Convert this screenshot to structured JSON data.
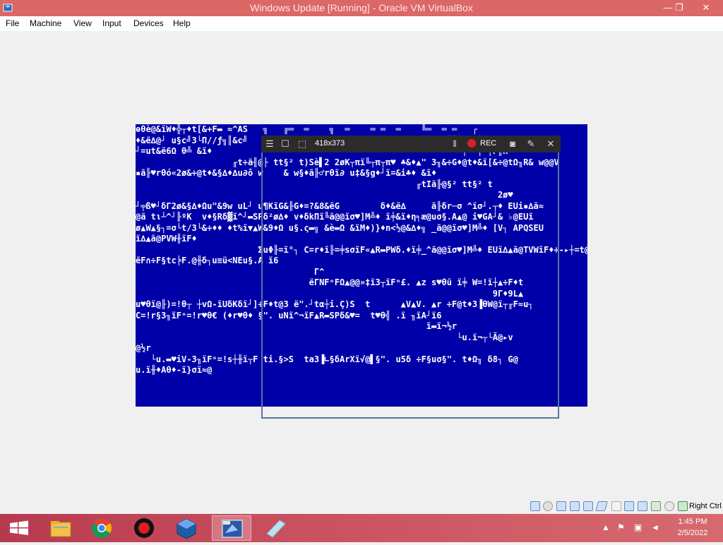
{
  "window": {
    "title": "Windows Update [Running] - Oracle VM VirtualBox",
    "minimize_icon": "minimize-icon",
    "maximize_icon": "restore-icon",
    "close_icon": "close-icon"
  },
  "menu": {
    "items": [
      "File",
      "Machine",
      "View",
      "Input",
      "Devices",
      "Help"
    ]
  },
  "vm_screen": {
    "bg_color": "#0000a8",
    "text": "ⱺθè@&ïW♦╬┬♦t[&+F▬ ≈^AS   ╗   ╔═  ═    ╗  ═    ═ ═  ═    ╚═  ═ ═   ┌\n♦&ë∆@┘ u§c╝3└Π//ƒ╗║&c╝                                      &╠║┼   ┼F§w@u\n┘=ut&ë6Ω θ╩ &ï♦                                                 ┼  ┼ ┼F║H\n                   ╓t÷ã╢@├ tt§² t)Sè▌2 2øK┬πï╚┬π┬π♥ ♣&♦▲\" 3╖&÷G♦@t♦&ï[&÷@tΩ╖R& w@@V\n▪ã╟♥rθó«2ø&÷@t♦&§∆♦∆u∂ô w    & w§♦ã╟♂rθï∂ u‡&§g♦┘ï=&i♣♦ &ï♦\n                                                       ╓tIã╟@§² tt§² t\n                                                                       2ø♥\n┘╤ß♥┘δΓ2ø&§∆♦Ωu\"&9w uL┘ u¶KïG&╟G♦=?&8&ëG        δ♦&ë∆     ã╟δr─σ ^ïσ┘.┬♦ EUi▪∆ã≈\n@ä tι┴^┘╟ºK  v♦§Rδ▓ï^┘▬SPδ²ø∆♦ v♦δkΠï╚ã@@ïσ♥]M╩♦ ï╪&ï♦η╕æ@uσ§.A▲@ i♥GA┘& ♭@EUï\nø▲W▲§┐=σ└t/3└&÷♦♦ ♦t%ï▼▲W&9♦Ω u§.ς▬╗ &è▬Ω &ïM♦)}♦n<½@&∆♦╗ _ã@@ïσ♥]M╩♦ [V┐ APQSEU\nï∆▲ã@PVW╫ïF♦\n                        ΣuΦ╟=ï°┐ C=r♦ï╟=╪sσïF«▲R▬PWδ.♦ï╪_^ã@@ïσ♥]M╩♦ EUï∆▲ã@TVWïF♦÷-▸┼=t@╟(\nëF∩÷F§tc╞F.@╫δ┐u≡ü<NEu§.A ï6\n                                   Γ^\n                                  ëΓNFⁿFΩ▲@@»‡ï3┬ïFⁿ£. ▲z s♥θü ï╪ W=!ï┼▲÷F♦t\n                                                                      9Γ♦9L▲\nu♥θï@╟)=!θ┬ ┼vΩ-ïUδKδï┘]÷F♦t@3 ë\".┘tα┼i.Ç)S  t      ▲V▲V. ▲r ÷F@t♦3▐θW@ï┬╓F≈u┐\nC=!r§3╖ïFⁿ=!r♥θ€ (♦r♥θ♦ §\". uNï^¬ïF▲R▬SPδ&♥=  t♥θ╣ .ï ╖ïA┘ï6\n                                                         ï▬ï¬½r\n                                                               └u.ï¬┬└Ã@▸v\n@½r\n   └u.▬♥iV-3╖ïFⁿ=!s┼╫ï┬F ti.§>S  ta3▐∟§δArXï√@▌§\". u5δ ÷F§uσ§\". t♦Ω╖ δ8┐ G@\nu.ï╫♦Aθ♦-ï}σï≈@"
  },
  "recorder": {
    "size_label": "418x373",
    "rec_label": "REC",
    "menu_icon": "menu-icon",
    "window_icon": "window-icon",
    "region_icon": "region-select-icon",
    "pause_icon": "pause-icon",
    "camera_icon": "camera-icon",
    "pen_icon": "pen-icon",
    "close_icon": "close-icon"
  },
  "statusbar": {
    "host_key": "Right Ctrl",
    "icons": [
      "hard-disk-icon",
      "optical-drive-icon",
      "floppy-icon",
      "audio-icon",
      "network-icon",
      "usb-icon",
      "shared-folder-icon",
      "display-icon",
      "video-capture-icon",
      "cpu-icon",
      "mouse-integration-icon",
      "keyboard-icon"
    ]
  },
  "taskbar": {
    "apps": [
      "start-icon",
      "file-explorer-icon",
      "chrome-icon",
      "recorder-app-icon",
      "virtualbox-icon",
      "virtualbox-vm-icon",
      "notes-app-icon"
    ],
    "time": "1:45 PM",
    "date": "2/5/2022"
  }
}
